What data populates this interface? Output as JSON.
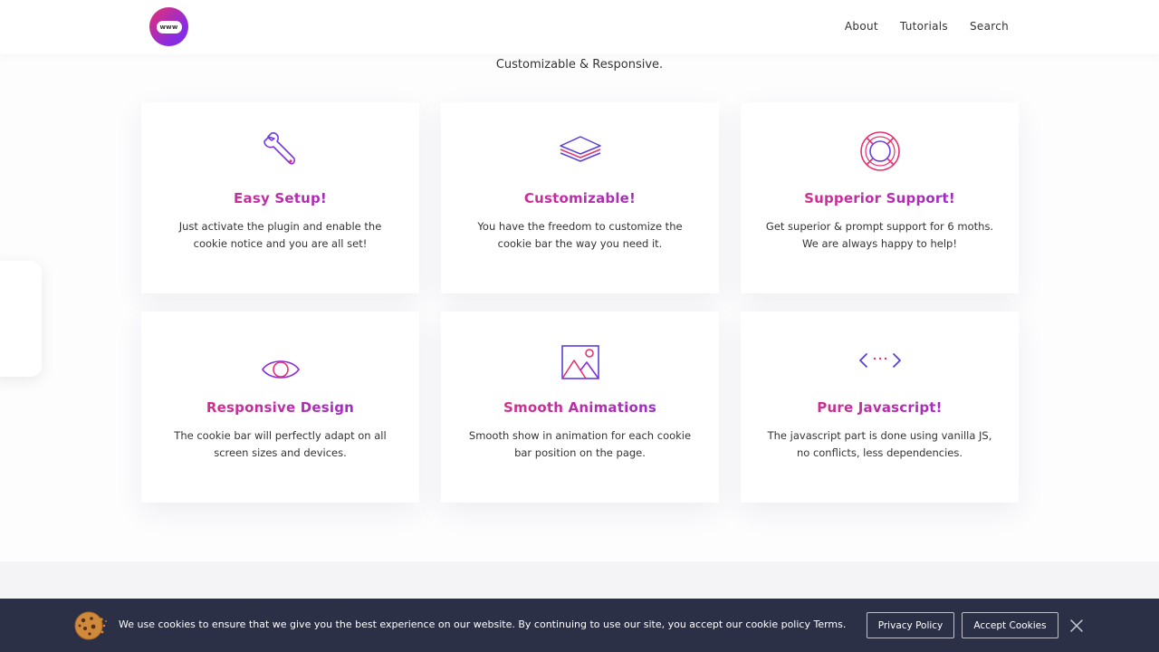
{
  "header": {
    "logo_text": "www",
    "nav": [
      "About",
      "Tutorials",
      "Search"
    ]
  },
  "subtitle": "Customizable & Responsive.",
  "features": [
    {
      "icon": "wrench-icon",
      "title": "Easy Setup!",
      "text": "Just activate the plugin and enable the cookie notice and you are all set!"
    },
    {
      "icon": "layers-icon",
      "title": "Customizable!",
      "text": "You have the freedom to customize the cookie bar the way you need it."
    },
    {
      "icon": "lifebuoy-icon",
      "title": "Supperior Support!",
      "text": "Get superior & prompt support for 6 moths. We are always happy to help!"
    },
    {
      "icon": "eye-icon",
      "title": "Responsive Design",
      "text": "The cookie bar will perfectly adapt on all screen sizes and devices."
    },
    {
      "icon": "image-icon",
      "title": "Smooth Animations",
      "text": "Smooth show in animation for each cookie bar position on the page."
    },
    {
      "icon": "code-icon",
      "title": "Pure Javascript!",
      "text": "The javascript part is done using vanilla JS, no conflicts, less dependencies."
    }
  ],
  "cookie_bar": {
    "message": "We use cookies to ensure that we give you the best experience on our website. By continuing to use our site, you accept our cookie policy Terms.",
    "privacy_label": "Privacy Policy",
    "accept_label": "Accept Cookies"
  },
  "colors": {
    "accent_pink": "#e8306f",
    "accent_purple": "#8a2be2",
    "cookie_bar_bg": "#2c3047"
  }
}
